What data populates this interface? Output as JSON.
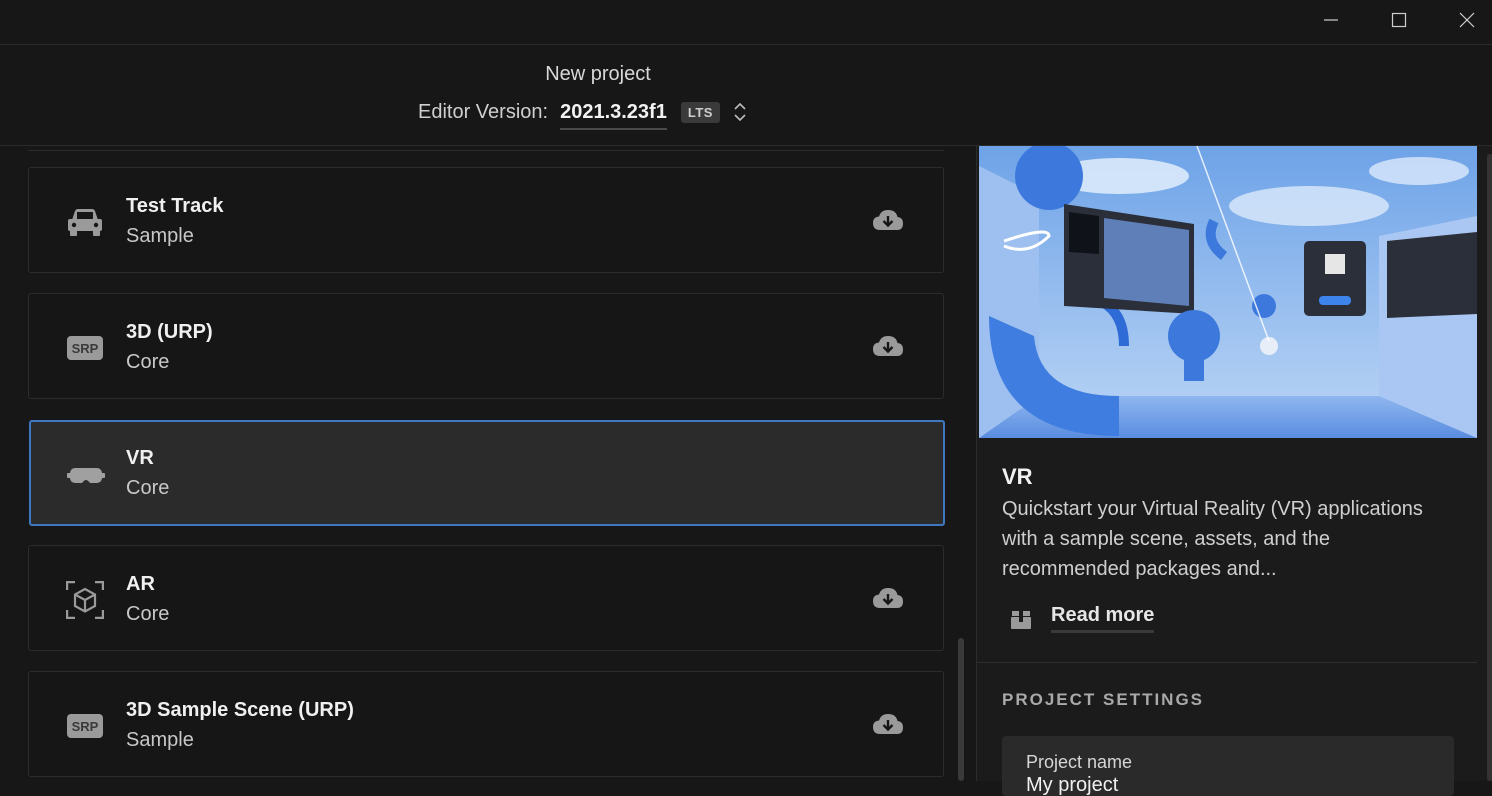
{
  "window": {
    "minimize_icon": "minimize-icon",
    "maximize_icon": "maximize-icon",
    "close_icon": "close-icon"
  },
  "header": {
    "title": "New project",
    "editor_version_label": "Editor Version:",
    "editor_version": "2021.3.23f1",
    "badge": "LTS"
  },
  "templates": [
    {
      "name": "Test Track",
      "category": "Sample",
      "icon": "car-icon",
      "download": true,
      "selected": false
    },
    {
      "name": "3D (URP)",
      "category": "Core",
      "icon": "srp-icon",
      "download": true,
      "selected": false
    },
    {
      "name": "VR",
      "category": "Core",
      "icon": "vr-headset-icon",
      "download": false,
      "selected": true
    },
    {
      "name": "AR",
      "category": "Core",
      "icon": "ar-cube-icon",
      "download": true,
      "selected": false
    },
    {
      "name": "3D Sample Scene (URP)",
      "category": "Sample",
      "icon": "srp-icon",
      "download": true,
      "selected": false
    }
  ],
  "details": {
    "title": "VR",
    "description": "Quickstart your Virtual Reality (VR) applications with a sample scene, assets, and the recommended packages and...",
    "read_more": "Read more",
    "settings_heading": "PROJECT SETTINGS",
    "project_name_label": "Project name",
    "project_name_value": "My project"
  },
  "colors": {
    "background": "#171717",
    "selected_border": "#3f78c2",
    "preview_blue": "#5b8fe0"
  }
}
